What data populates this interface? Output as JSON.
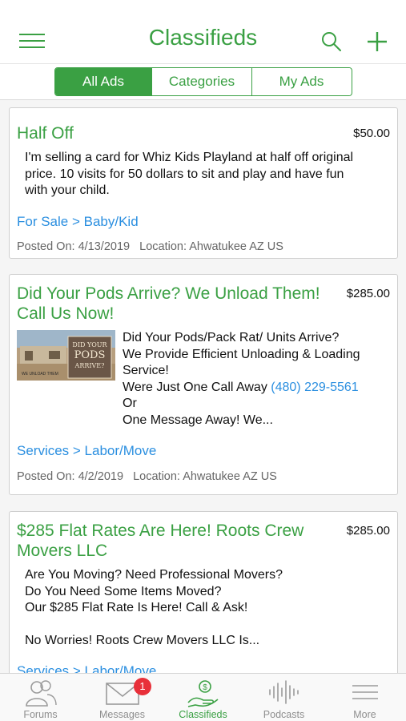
{
  "header": {
    "title": "Classifieds",
    "menu_icon": "hamburger-icon",
    "search_icon": "search-icon",
    "add_icon": "plus-icon"
  },
  "segments": [
    {
      "label": "All Ads",
      "active": true
    },
    {
      "label": "Categories",
      "active": false
    },
    {
      "label": "My Ads",
      "active": false
    }
  ],
  "ads": [
    {
      "title": "Half Off",
      "price": "$50.00",
      "description_lines": [
        "I'm selling a card for Whiz Kids Playland at half off original",
        "price. 10 visits for 50 dollars to sit and play and have fun",
        "with your child."
      ],
      "category": "For Sale > Baby/Kid",
      "posted": "Posted On: 4/13/2019",
      "location": "Location: Ahwatukee AZ US"
    },
    {
      "title_lines": [
        "Did Your Pods Arrive? We Unload Them!",
        "Call Us Now!"
      ],
      "price": "$285.00",
      "image_text": {
        "line1": "DID YOUR",
        "line2": "PODS",
        "line3": "ARRIVE?",
        "caption": "WE UNLOAD THEM"
      },
      "description_lines": [
        "Did Your Pods/Pack Rat/ Units Arrive?",
        "We Provide Efficient Unloading & Loading",
        "Service!",
        "Were Just One Call Away",
        "Or",
        "One Message Away! We..."
      ],
      "phone": "(480) 229-5561",
      "category": "Services > Labor/Move",
      "posted": "Posted On: 4/2/2019",
      "location": "Location: Ahwatukee AZ US"
    },
    {
      "title_lines": [
        "$285 Flat Rates Are Here! Roots Crew",
        "Movers LLC"
      ],
      "price": "$285.00",
      "description_lines": [
        "Are You Moving? Need Professional Movers?",
        "Do You Need Some Items Moved?",
        "Our $285 Flat Rate Is Here! Call & Ask!",
        "",
        "No Worries! Roots Crew Movers LLC Is..."
      ],
      "category": "Services > Labor/Move"
    }
  ],
  "tabs": [
    {
      "label": "Forums",
      "icon": "people-icon",
      "active": false
    },
    {
      "label": "Messages",
      "icon": "envelope-icon",
      "active": false,
      "badge": "1"
    },
    {
      "label": "Classifieds",
      "icon": "hand-coin-icon",
      "active": true
    },
    {
      "label": "Podcasts",
      "icon": "waveform-icon",
      "active": false
    },
    {
      "label": "More",
      "icon": "menu-lines-icon",
      "active": false
    }
  ],
  "colors": {
    "accent": "#3aa043",
    "link": "#2b8fe0",
    "badge": "#e8303a"
  }
}
